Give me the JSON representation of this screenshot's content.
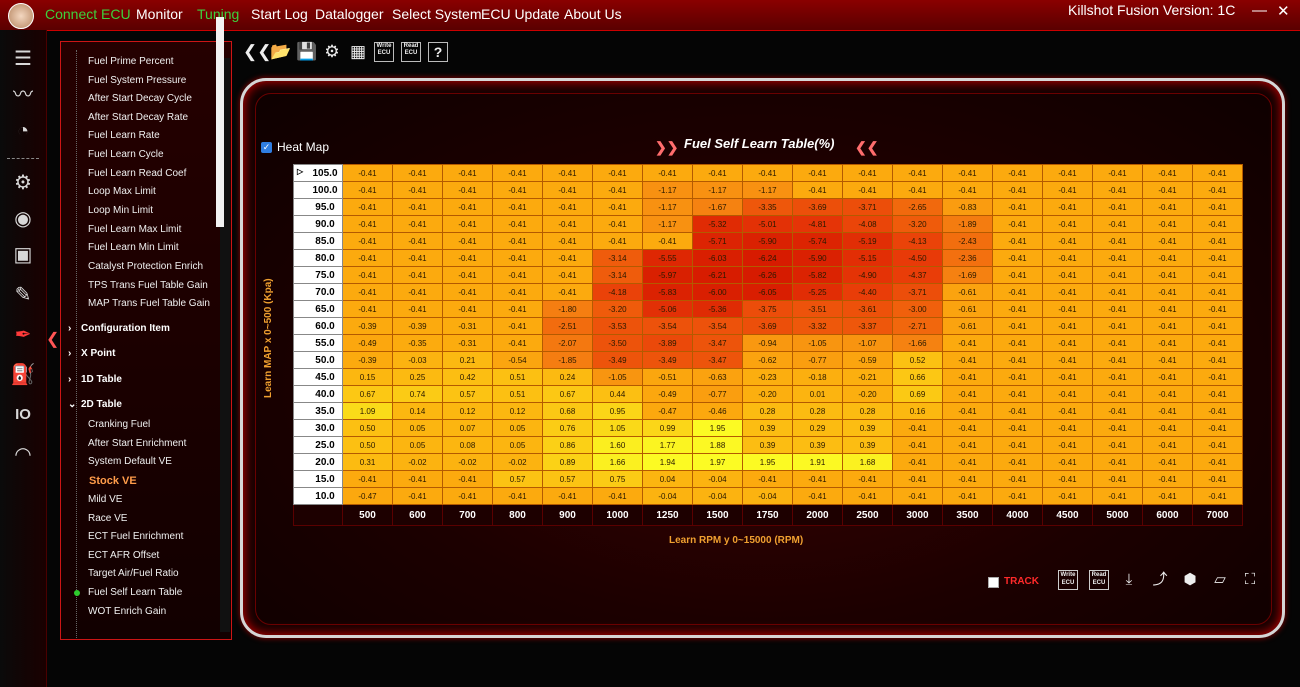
{
  "menubar": {
    "items": [
      {
        "label": "Connect ECU",
        "color": "green"
      },
      {
        "label": "Monitor",
        "color": "white"
      },
      {
        "label": "Tuning",
        "color": "green"
      },
      {
        "label": "Start Log",
        "color": "white"
      },
      {
        "label": "Datalogger",
        "color": "white"
      },
      {
        "label": "Select System",
        "color": "white"
      },
      {
        "label": "ECU Update",
        "color": "white"
      },
      {
        "label": "About Us",
        "color": "white"
      }
    ],
    "version": "Killshot Fusion Version: 1C",
    "minimize": "—",
    "close": "✕"
  },
  "sidebar_icons": [
    "list-icon",
    "pulse-icon",
    "gauge-icon",
    "gear-icon",
    "signal-icon",
    "engine-icon",
    "spark-plug-icon",
    "injector-icon",
    "fuel-pump-icon",
    "io-icon",
    "speedometer-lock-icon"
  ],
  "tree": {
    "items": [
      {
        "label": "Fuel Prime Percent",
        "type": "item"
      },
      {
        "label": "Fuel System Pressure",
        "type": "item"
      },
      {
        "label": "After Start Decay Cycle",
        "type": "item"
      },
      {
        "label": "After Start Decay Rate",
        "type": "item"
      },
      {
        "label": "Fuel Learn Rate",
        "type": "item"
      },
      {
        "label": "Fuel Learn Cycle",
        "type": "item"
      },
      {
        "label": "Fuel Learn Read Coef",
        "type": "item"
      },
      {
        "label": "Loop Max Limit",
        "type": "item"
      },
      {
        "label": "Loop Min Limit",
        "type": "item"
      },
      {
        "label": "Fuel Learn Max Limit",
        "type": "item"
      },
      {
        "label": "Fuel Learn Min Limit",
        "type": "item"
      },
      {
        "label": "Catalyst Protection Enrich",
        "type": "item"
      },
      {
        "label": "TPS Trans Fuel Table Gain",
        "type": "item"
      },
      {
        "label": "MAP Trans Fuel Table Gain",
        "type": "item"
      },
      {
        "label": "Configuration Item",
        "type": "section"
      },
      {
        "label": "X Point",
        "type": "section"
      },
      {
        "label": "1D Table",
        "type": "section"
      },
      {
        "label": "2D Table",
        "type": "section"
      },
      {
        "label": "Cranking Fuel",
        "type": "item"
      },
      {
        "label": "After Start Enrichment",
        "type": "item"
      },
      {
        "label": "System Default VE",
        "type": "item"
      },
      {
        "label": "Stock VE",
        "type": "selected"
      },
      {
        "label": "Mild VE",
        "type": "item"
      },
      {
        "label": "Race VE",
        "type": "item"
      },
      {
        "label": "ECT Fuel Enrichment",
        "type": "item"
      },
      {
        "label": "ECT AFR Offset",
        "type": "item"
      },
      {
        "label": "Target Air/Fuel Ratio",
        "type": "item"
      },
      {
        "label": "Fuel Self Learn Table",
        "type": "active"
      },
      {
        "label": "WOT Enrich Gain",
        "type": "item"
      }
    ]
  },
  "toolbar": {
    "write_label": "Write ECU",
    "read_label": "Read ECU",
    "help": "?"
  },
  "table_panel": {
    "heatmap_label": "Heat Map",
    "heatmap_checked": true,
    "title": "Fuel Self Learn Table(%)",
    "y_axis_label": "Learn MAP x  0~500 (Kpa)",
    "x_axis_label": "Learn RPM y  0~15000 (RPM)",
    "track_label": "TRACK",
    "bottom_write": "Write ECU",
    "bottom_read": "Read ECU"
  },
  "chart_data": {
    "type": "table",
    "title": "Fuel Self Learn Table(%)",
    "xlabel": "Learn RPM y  0~15000 (RPM)",
    "ylabel": "Learn MAP x  0~500 (Kpa)",
    "columns": [
      "500",
      "600",
      "700",
      "800",
      "900",
      "1000",
      "1250",
      "1500",
      "1750",
      "2000",
      "2500",
      "3000",
      "3500",
      "4000",
      "4500",
      "5000",
      "6000",
      "7000"
    ],
    "rows": [
      "105.0",
      "100.0",
      "95.0",
      "90.0",
      "85.0",
      "80.0",
      "75.0",
      "70.0",
      "65.0",
      "60.0",
      "55.0",
      "50.0",
      "45.0",
      "40.0",
      "35.0",
      "30.0",
      "25.0",
      "20.0",
      "15.0",
      "10.0"
    ],
    "values": [
      [
        "-0.41",
        "-0.41",
        "-0.41",
        "-0.41",
        "-0.41",
        "-0.41",
        "-0.41",
        "-0.41",
        "-0.41",
        "-0.41",
        "-0.41",
        "-0.41",
        "-0.41",
        "-0.41",
        "-0.41",
        "-0.41",
        "-0.41",
        "-0.41"
      ],
      [
        "-0.41",
        "-0.41",
        "-0.41",
        "-0.41",
        "-0.41",
        "-0.41",
        "-1.17",
        "-1.17",
        "-1.17",
        "-0.41",
        "-0.41",
        "-0.41",
        "-0.41",
        "-0.41",
        "-0.41",
        "-0.41",
        "-0.41",
        "-0.41"
      ],
      [
        "-0.41",
        "-0.41",
        "-0.41",
        "-0.41",
        "-0.41",
        "-0.41",
        "-1.17",
        "-1.67",
        "-3.35",
        "-3.69",
        "-3.71",
        "-2.65",
        "-0.83",
        "-0.41",
        "-0.41",
        "-0.41",
        "-0.41",
        "-0.41"
      ],
      [
        "-0.41",
        "-0.41",
        "-0.41",
        "-0.41",
        "-0.41",
        "-0.41",
        "-1.17",
        "-5.32",
        "-5.01",
        "-4.81",
        "-4.08",
        "-3.20",
        "-1.89",
        "-0.41",
        "-0.41",
        "-0.41",
        "-0.41",
        "-0.41"
      ],
      [
        "-0.41",
        "-0.41",
        "-0.41",
        "-0.41",
        "-0.41",
        "-0.41",
        "-0.41",
        "-5.71",
        "-5.90",
        "-5.74",
        "-5.19",
        "-4.13",
        "-2.43",
        "-0.41",
        "-0.41",
        "-0.41",
        "-0.41",
        "-0.41"
      ],
      [
        "-0.41",
        "-0.41",
        "-0.41",
        "-0.41",
        "-0.41",
        "-3.14",
        "-5.55",
        "-6.03",
        "-6.24",
        "-5.90",
        "-5.15",
        "-4.50",
        "-2.36",
        "-0.41",
        "-0.41",
        "-0.41",
        "-0.41",
        "-0.41"
      ],
      [
        "-0.41",
        "-0.41",
        "-0.41",
        "-0.41",
        "-0.41",
        "-3.14",
        "-5.97",
        "-6.21",
        "-6.26",
        "-5.82",
        "-4.90",
        "-4.37",
        "-1.69",
        "-0.41",
        "-0.41",
        "-0.41",
        "-0.41",
        "-0.41"
      ],
      [
        "-0.41",
        "-0.41",
        "-0.41",
        "-0.41",
        "-0.41",
        "-4.18",
        "-5.83",
        "-6.00",
        "-6.05",
        "-5.25",
        "-4.40",
        "-3.71",
        "-0.61",
        "-0.41",
        "-0.41",
        "-0.41",
        "-0.41",
        "-0.41"
      ],
      [
        "-0.41",
        "-0.41",
        "-0.41",
        "-0.41",
        "-1.80",
        "-3.20",
        "-5.06",
        "-5.36",
        "-3.75",
        "-3.51",
        "-3.61",
        "-3.00",
        "-0.61",
        "-0.41",
        "-0.41",
        "-0.41",
        "-0.41",
        "-0.41"
      ],
      [
        "-0.39",
        "-0.39",
        "-0.31",
        "-0.41",
        "-2.51",
        "-3.53",
        "-3.54",
        "-3.54",
        "-3.69",
        "-3.32",
        "-3.37",
        "-2.71",
        "-0.61",
        "-0.41",
        "-0.41",
        "-0.41",
        "-0.41",
        "-0.41"
      ],
      [
        "-0.49",
        "-0.35",
        "-0.31",
        "-0.41",
        "-2.07",
        "-3.50",
        "-3.89",
        "-3.47",
        "-0.94",
        "-1.05",
        "-1.07",
        "-1.66",
        "-0.41",
        "-0.41",
        "-0.41",
        "-0.41",
        "-0.41",
        "-0.41"
      ],
      [
        "-0.39",
        "-0.03",
        "0.21",
        "-0.54",
        "-1.85",
        "-3.49",
        "-3.49",
        "-3.47",
        "-0.62",
        "-0.77",
        "-0.59",
        "0.52",
        "-0.41",
        "-0.41",
        "-0.41",
        "-0.41",
        "-0.41",
        "-0.41"
      ],
      [
        "0.15",
        "0.25",
        "0.42",
        "0.51",
        "0.24",
        "-1.05",
        "-0.51",
        "-0.63",
        "-0.23",
        "-0.18",
        "-0.21",
        "0.66",
        "-0.41",
        "-0.41",
        "-0.41",
        "-0.41",
        "-0.41",
        "-0.41"
      ],
      [
        "0.67",
        "0.74",
        "0.57",
        "0.51",
        "0.67",
        "0.44",
        "-0.49",
        "-0.77",
        "-0.20",
        "0.01",
        "-0.20",
        "0.69",
        "-0.41",
        "-0.41",
        "-0.41",
        "-0.41",
        "-0.41",
        "-0.41"
      ],
      [
        "1.09",
        "0.14",
        "0.12",
        "0.12",
        "0.68",
        "0.95",
        "-0.47",
        "-0.46",
        "0.28",
        "0.28",
        "0.28",
        "0.16",
        "-0.41",
        "-0.41",
        "-0.41",
        "-0.41",
        "-0.41",
        "-0.41"
      ],
      [
        "0.50",
        "0.05",
        "0.07",
        "0.05",
        "0.76",
        "1.05",
        "0.99",
        "1.95",
        "0.39",
        "0.29",
        "0.39",
        "-0.41",
        "-0.41",
        "-0.41",
        "-0.41",
        "-0.41",
        "-0.41",
        "-0.41"
      ],
      [
        "0.50",
        "0.05",
        "0.08",
        "0.05",
        "0.86",
        "1.60",
        "1.77",
        "1.88",
        "0.39",
        "0.39",
        "0.39",
        "-0.41",
        "-0.41",
        "-0.41",
        "-0.41",
        "-0.41",
        "-0.41",
        "-0.41"
      ],
      [
        "0.31",
        "-0.02",
        "-0.02",
        "-0.02",
        "0.89",
        "1.66",
        "1.94",
        "1.97",
        "1.95",
        "1.91",
        "1.68",
        "-0.41",
        "-0.41",
        "-0.41",
        "-0.41",
        "-0.41",
        "-0.41",
        "-0.41"
      ],
      [
        "-0.41",
        "-0.41",
        "-0.41",
        "0.57",
        "0.57",
        "0.75",
        "0.04",
        "-0.04",
        "-0.41",
        "-0.41",
        "-0.41",
        "-0.41",
        "-0.41",
        "-0.41",
        "-0.41",
        "-0.41",
        "-0.41",
        "-0.41"
      ],
      [
        "-0.47",
        "-0.41",
        "-0.41",
        "-0.41",
        "-0.41",
        "-0.41",
        "-0.04",
        "-0.04",
        "-0.04",
        "-0.41",
        "-0.41",
        "-0.41",
        "-0.41",
        "-0.41",
        "-0.41",
        "-0.41",
        "-0.41",
        "-0.41"
      ]
    ],
    "selected_row": "105.0",
    "heatmap": true
  },
  "colors": {
    "accent_red": "#cc1515",
    "menu_green": "#3dd13d",
    "axis_label": "#f0a030",
    "track_red": "#ff2a2a"
  }
}
